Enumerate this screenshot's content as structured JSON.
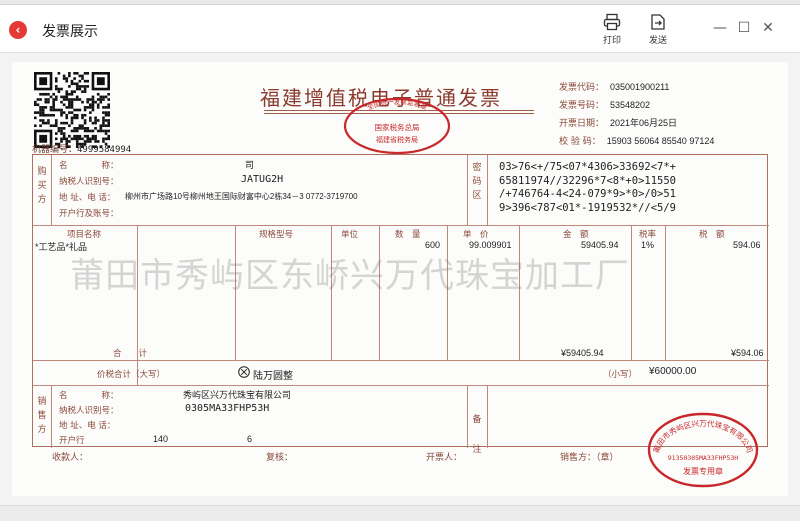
{
  "window": {
    "title": "发票展示",
    "back_icon": "back-icon",
    "toolbar": {
      "print_label": "打印",
      "send_label": "发送"
    },
    "controls": {
      "minimize": "—",
      "maximize": "☐",
      "close": "✕"
    }
  },
  "invoice": {
    "title": "福建增值税电子普通发票",
    "machine_label": "机器编号：",
    "machine_no": "4999584994",
    "meta": [
      {
        "label": "发票代码：",
        "value": "035001900211"
      },
      {
        "label": "发票号码：",
        "value": "53548202"
      },
      {
        "label": "开票日期：",
        "value": "2021年06月25日"
      },
      {
        "label": "校 验 码：",
        "value": "15903 56064 85540 97124"
      }
    ],
    "buyer": {
      "section_label": "购买方",
      "name_label": "名　　　　称：",
      "name_value": "司",
      "taxid_label": "纳税人识别号：",
      "taxid_value": "JATUG2H",
      "address_label": "地 址、电 话：",
      "address_value": "柳州市广场路10号柳州地王国际财富中心2栋34－3 0772-3719700",
      "bank_label": "开户行及账号："
    },
    "cipher_label": "密码区",
    "cipher_lines": [
      "03>76<+/75<07*4306>33692<7*+",
      "65811974//32296*7<8*+0>11550",
      "/+746764-4<24-079*9>*0>/0>51",
      "9>396<787<01*-1919532*//<5/9"
    ],
    "columns": {
      "item": "项目名称",
      "spec": "规格型号",
      "unit": "单位",
      "qty": "数　量",
      "price": "单　价",
      "amount": "金　额",
      "rate": "税率",
      "tax": "税　额"
    },
    "items": [
      {
        "name": "*工艺品*礼品",
        "qty": "600",
        "price": "99.009901",
        "amount": "59405.94",
        "rate": "1%",
        "tax": "594.06"
      }
    ],
    "total_label": "合　　计",
    "total_amount": "¥59405.94",
    "total_tax": "¥594.06",
    "grand": {
      "label": "价税合计（大写）",
      "capital": "陆万圆整",
      "small_label": "（小写）",
      "small_value": "¥60000.00"
    },
    "seller": {
      "section_label": "销售方",
      "name_label": "名　　　　称：",
      "name_value": "秀屿区兴万代珠宝有限公司",
      "taxid_label": "纳税人识别号：",
      "taxid_value": "0305MA33FHP53H",
      "address_label": "地 址、电 话：",
      "bank_label": "开户行",
      "bank_value": "140",
      "bank_value_tail": "6"
    },
    "remark_label": "备注",
    "watermark": "莆田市秀屿区东峤兴万代珠宝加工厂",
    "footer": {
      "payee": "收款人：",
      "reviewer": "复核：",
      "issuer": "开票人：",
      "seller_sign": "销售方：（章）"
    },
    "tax_seal": {
      "top_text": "全国统一发票监制章",
      "middle": "国家税务总局",
      "bottom": "福建省税务局"
    },
    "company_seal": {
      "ring_text": "莆田市秀屿区兴万代珠宝有限公司",
      "code": "91350305MA33FHP53H",
      "bottom": "发票专用章"
    }
  },
  "colors": {
    "ink": "#8a4a3a",
    "seal_red": "#c8282a",
    "watermark": "#9a9a9a"
  }
}
